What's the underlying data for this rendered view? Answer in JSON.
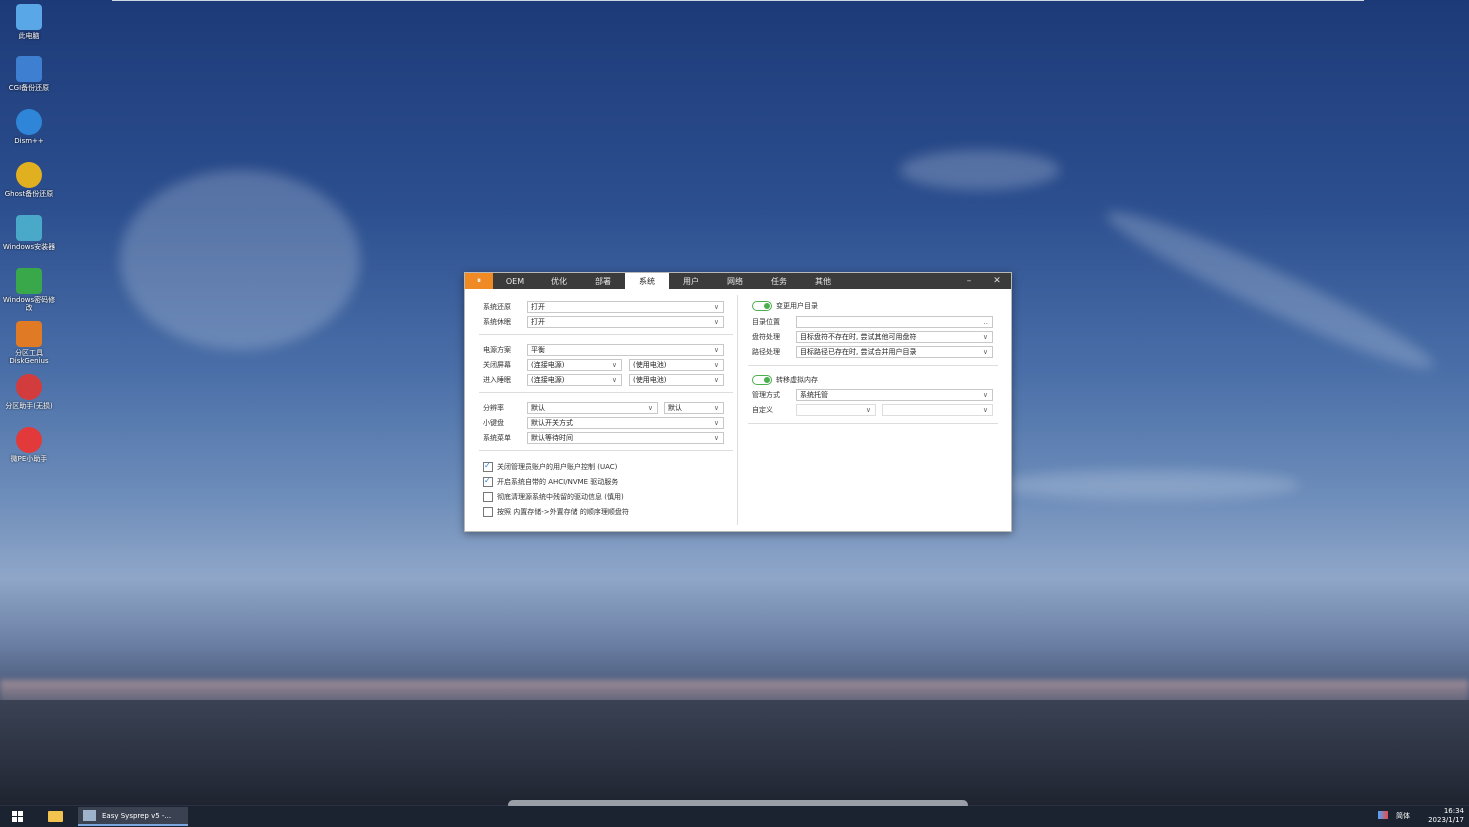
{
  "desktop": {
    "icons": [
      {
        "label": "此电脑",
        "icon": "computer-icon",
        "color": "#5aa7e8"
      },
      {
        "label": "CGI备份还原",
        "icon": "cgi-backup-icon",
        "color": "#3f7fd1"
      },
      {
        "label": "Dism++",
        "icon": "gears-icon",
        "color": "#2f86d8"
      },
      {
        "label": "Ghost备份还原",
        "icon": "ghost-icon",
        "color": "#e0b020"
      },
      {
        "label": "Windows安装器",
        "icon": "installer-icon",
        "color": "#4aa8c8"
      },
      {
        "label": "Windows密码修改",
        "icon": "lock-icon",
        "color": "#39a84a"
      },
      {
        "label": "分区工具DiskGenius",
        "icon": "diskgenius-icon",
        "color": "#e07a24"
      },
      {
        "label": "分区助手(无损)",
        "icon": "partition-assistant-icon",
        "color": "#d23c3c"
      },
      {
        "label": "微PE小助手",
        "icon": "lifebuoy-icon",
        "color": "#e23a3a"
      }
    ]
  },
  "window": {
    "app_icon_glyph": "⏸",
    "tabs": [
      "OEM",
      "优化",
      "部署",
      "系统",
      "用户",
      "网络",
      "任务",
      "其他"
    ],
    "active_tab": "系统",
    "minimize": "–",
    "close": "✕",
    "left": {
      "restore_label": "系统还原",
      "restore_value": "打开",
      "hibernate_label": "系统休眠",
      "hibernate_value": "打开",
      "power_plan_label": "电源方案",
      "power_plan_value": "平衡",
      "screen_off_label": "关闭屏幕",
      "screen_off_ac": "(连接电源)",
      "screen_off_dc": "(使用电池)",
      "sleep_label": "进入睡眠",
      "sleep_ac": "(连接电源)",
      "sleep_dc": "(使用电池)",
      "resolution_label": "分辨率",
      "resolution_value": "默认",
      "resolution_extra": "默认",
      "keyboard_label": "小键盘",
      "keyboard_value": "默认开关方式",
      "menu_label": "系统菜单",
      "menu_value": "默认等待时间",
      "checks": [
        {
          "label": "关闭管理员账户的用户账户控制 (UAC)",
          "checked": true
        },
        {
          "label": "开启系统自带的 AHCI/NVME 驱动服务",
          "checked": true
        },
        {
          "label": "彻底清理源系统中残留的驱动信息 (慎用)",
          "checked": false
        },
        {
          "label": "按照 内置存储->外置存储 的顺序理顺盘符",
          "checked": false
        }
      ]
    },
    "right": {
      "user_dir_toggle_label": "变更用户目录",
      "dir_location_label": "目录位置",
      "dir_location_value": "",
      "dir_browse": "..",
      "drive_label": "盘符处理",
      "drive_value": "目标盘符不存在时, 尝试其他可用盘符",
      "path_label": "路径处理",
      "path_value": "目标路径已存在时, 尝试合并用户目录",
      "vm_toggle_label": "转移虚拟内存",
      "manage_label": "管理方式",
      "manage_value": "系统托管",
      "custom_label": "自定义"
    }
  },
  "taskbar": {
    "app_label": "Easy Sysprep v5 -...",
    "ime": "简体",
    "time": "16:34",
    "date": "2023/1/17"
  }
}
